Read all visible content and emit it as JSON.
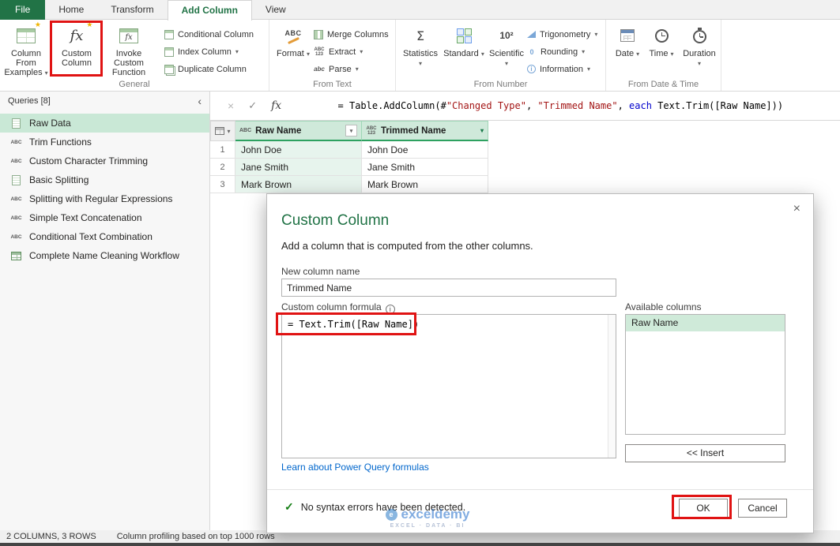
{
  "colors": {
    "accent_green": "#217346",
    "selection_green": "#cde9d8",
    "annotation_red": "#e01313",
    "link_blue": "#0066cc",
    "formula_string_red": "#a31515",
    "formula_keyword_blue": "#0000cc"
  },
  "tabs": {
    "file": "File",
    "home": "Home",
    "transform": "Transform",
    "add_column": "Add Column",
    "view": "View"
  },
  "ribbon": {
    "general": {
      "label": "General",
      "column_from_examples": "Column From Examples",
      "custom_column": "Custom Column",
      "invoke_custom_function": "Invoke Custom Function",
      "conditional_column": "Conditional Column",
      "index_column": "Index Column",
      "duplicate_column": "Duplicate Column"
    },
    "from_text": {
      "label": "From Text",
      "format": "Format",
      "merge_columns": "Merge Columns",
      "extract": "Extract",
      "parse": "Parse"
    },
    "from_number": {
      "label": "From Number",
      "statistics": "Statistics",
      "standard": "Standard",
      "scientific": "Scientific",
      "trigonometry": "Trigonometry",
      "rounding": "Rounding",
      "information": "Information"
    },
    "from_datetime": {
      "label": "From Date & Time",
      "date": "Date",
      "time": "Time",
      "duration": "Duration"
    }
  },
  "queries": {
    "title": "Queries [8]",
    "items": [
      {
        "name": "Raw Data"
      },
      {
        "name": "Trim Functions"
      },
      {
        "name": "Custom Character Trimming"
      },
      {
        "name": "Basic Splitting"
      },
      {
        "name": "Splitting with Regular Expressions"
      },
      {
        "name": "Simple Text Concatenation"
      },
      {
        "name": "Conditional Text Combination"
      },
      {
        "name": "Complete Name Cleaning Workflow"
      }
    ]
  },
  "formula_bar": {
    "parts": [
      {
        "text": "= Table.AddColumn(#"
      },
      {
        "text": "\"Changed Type\""
      },
      {
        "text": ", "
      },
      {
        "text": "\"Trimmed Name\""
      },
      {
        "text": ", "
      },
      {
        "text": "each"
      },
      {
        "text": " Text.Trim([Raw Name]))"
      }
    ]
  },
  "table": {
    "columns": [
      {
        "name": "Raw Name"
      },
      {
        "name": "Trimmed Name"
      }
    ],
    "rows": [
      {
        "num": "1",
        "raw": "John Doe",
        "trimmed": "John Doe"
      },
      {
        "num": "2",
        "raw": "Jane Smith",
        "trimmed": "Jane Smith"
      },
      {
        "num": "3",
        "raw": "Mark Brown",
        "trimmed": "Mark Brown"
      }
    ]
  },
  "dialog": {
    "title": "Custom Column",
    "description": "Add a column that is computed from the other columns.",
    "new_column_label": "New column name",
    "new_column_value": "Trimmed Name",
    "formula_label": "Custom column formula",
    "formula_value": "= Text.Trim([Raw Name])",
    "available_columns_label": "Available columns",
    "available_columns": [
      {
        "name": "Raw Name"
      }
    ],
    "insert_button": "<< Insert",
    "learn_link": "Learn about Power Query formulas",
    "syntax_status": "No syntax errors have been detected.",
    "ok_button": "OK",
    "cancel_button": "Cancel"
  },
  "status_bar": {
    "left": "2 COLUMNS, 3 ROWS",
    "right": "Column profiling based on top 1000 rows"
  },
  "watermark": {
    "brand": "exceldemy",
    "tagline": "EXCEL · DATA · BI"
  },
  "icons": {
    "dropdown": "▾",
    "collapse_left": "‹",
    "close": "×",
    "check": "✓",
    "fx": "fx",
    "abc": "ABC",
    "num123": "123",
    "parse": "abc",
    "sigma": "Σ",
    "scientific": "10²",
    "info": "i",
    "star": "★",
    "zero": "0",
    "logo_letter": "e"
  }
}
